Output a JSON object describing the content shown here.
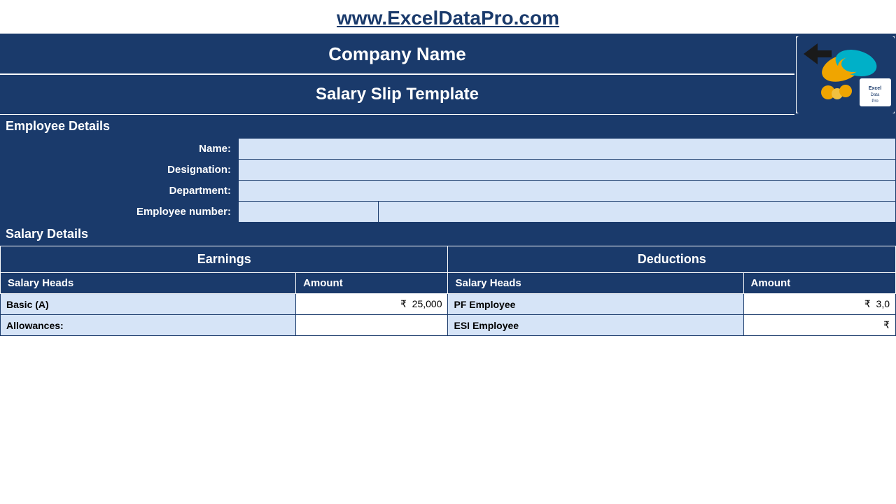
{
  "url": {
    "display": "www.ExcelDataPro.com",
    "href": "http://www.ExcelDataPro.com"
  },
  "header": {
    "company_name": "Company Name",
    "title": "Salary Slip Template"
  },
  "employee_section": {
    "heading": "Employee Details",
    "fields": [
      {
        "label": "Name:",
        "value": "",
        "colspan": true
      },
      {
        "label": "Designation:",
        "value": "",
        "colspan": true
      },
      {
        "label": "Department:",
        "value": "",
        "colspan": true
      },
      {
        "label": "Employee number:",
        "value": "",
        "value2": ""
      }
    ]
  },
  "salary_section": {
    "heading": "Salary Details",
    "earnings_header": "Earnings",
    "deductions_header": "Deductions",
    "earnings_subheaders": [
      "Salary Heads",
      "Amount"
    ],
    "deductions_subheaders": [
      "Salary Heads",
      "Amount"
    ],
    "rows": [
      {
        "earning_head": "Basic (A)",
        "earning_amount": "₹  25,000",
        "deduction_head": "PF Employee",
        "deduction_amount": "₹  3,0"
      },
      {
        "earning_head": "Allowances:",
        "earning_amount": "",
        "deduction_head": "ESI Employee",
        "deduction_amount": "₹"
      }
    ]
  }
}
